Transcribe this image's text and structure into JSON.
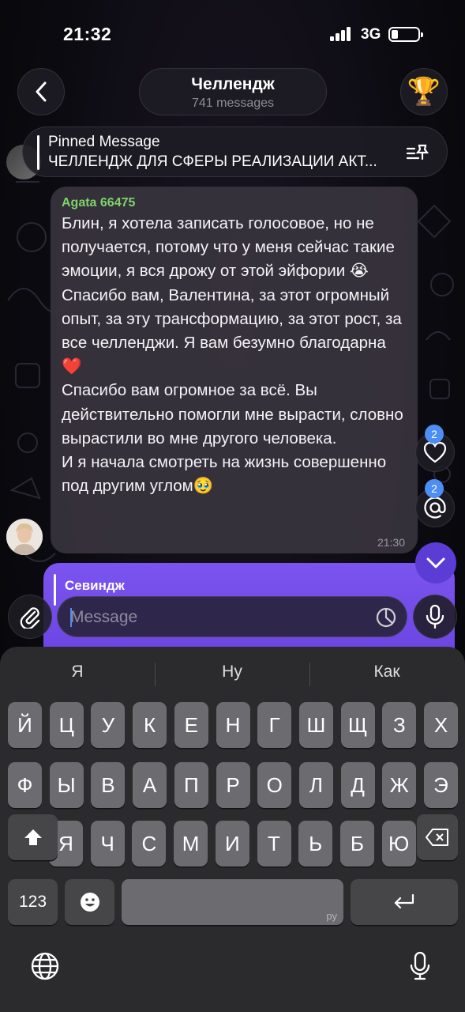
{
  "status_bar": {
    "time": "21:32",
    "network": "3G"
  },
  "header": {
    "title": "Челлендж",
    "subtitle": "741 messages",
    "trophy_icon": "🏆"
  },
  "pinned": {
    "label": "Pinned Message",
    "text": "ЧЕЛЛЕНДЖ ДЛЯ СФЕРЫ РЕАЛИЗАЦИИ АКТ..."
  },
  "message": {
    "sender": "Agata 66475",
    "text": "Блин, я хотела записать голосовое, но не получается, потому что у меня сейчас такие эмоции, я вся дрожу от этой эйфории 😭\nСпасибо вам, Валентина, за этот огромный опыт, за эту трансформацию, за этот рост, за все челленджи. Я вам безумно благодарна ❤️\nСпасибо вам огромное за всё. Вы действительно помогли мне вырасти, словно вырастили во мне другого человека.\nИ я начала смотреть на жизнь совершенно под другим углом🥹",
    "time": "21:30"
  },
  "floating": {
    "reactions_badge": "2",
    "mentions_badge": "2"
  },
  "reply_preview": {
    "name": "Севиндж"
  },
  "composer": {
    "placeholder": "Message"
  },
  "keyboard": {
    "suggestions": [
      "Я",
      "Ну",
      "Как"
    ],
    "row1": [
      "Й",
      "Ц",
      "У",
      "К",
      "Е",
      "Н",
      "Г",
      "Ш",
      "Щ",
      "З",
      "Х"
    ],
    "row2": [
      "Ф",
      "Ы",
      "В",
      "А",
      "П",
      "Р",
      "О",
      "Л",
      "Д",
      "Ж",
      "Э"
    ],
    "row3": [
      "Я",
      "Ч",
      "С",
      "М",
      "И",
      "Т",
      "Ь",
      "Б",
      "Ю"
    ],
    "numbers_key": "123",
    "space_lang": "ру"
  },
  "colors": {
    "sender": "#7ed46a",
    "accent": "#4d8ef5",
    "outgoing": "#7b54f0"
  }
}
